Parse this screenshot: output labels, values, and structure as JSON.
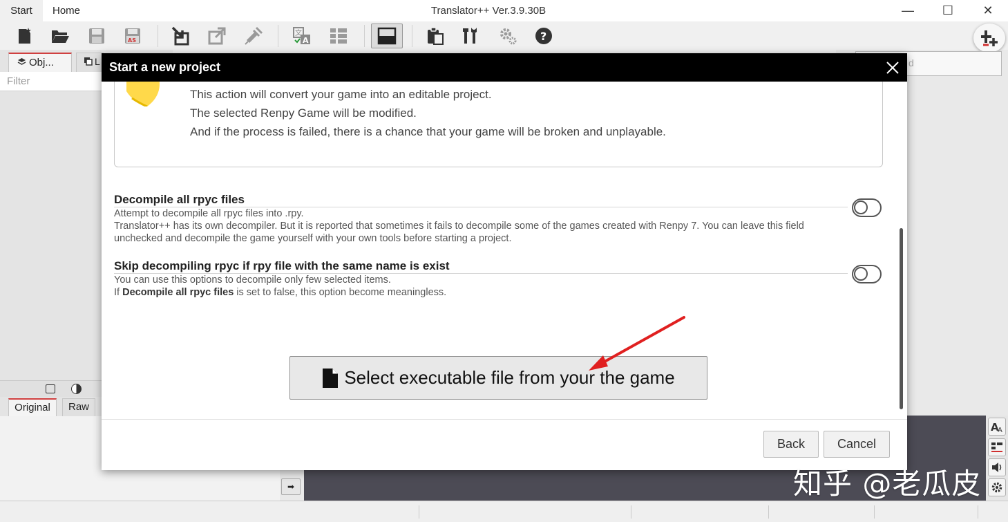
{
  "window": {
    "title": "Translator++ Ver.3.9.30B",
    "menus": [
      "Start",
      "Home"
    ],
    "minimize_glyph": "—",
    "maximize_glyph": "☐",
    "close_glyph": "✕"
  },
  "toolbar": {
    "icons": [
      "new-project-icon",
      "open-folder-icon",
      "save-icon",
      "save-as-icon",
      "import-icon",
      "export-icon",
      "inject-icon",
      "translate-icon",
      "list-view-icon",
      "layout-icon",
      "clipboard-icon",
      "tools-icon",
      "settings-icon",
      "help-icon"
    ],
    "add_glyph": "+"
  },
  "left_panel": {
    "tabs": [
      "Obj...",
      "L"
    ],
    "filter_placeholder": "Filter"
  },
  "behind": {
    "search_fragment": "d"
  },
  "lower_panel": {
    "tabs": [
      "Original",
      "Raw"
    ],
    "nav_arrow": "➡"
  },
  "modal": {
    "title": "Start a new project",
    "warning_lines": [
      "This action will convert your game into an editable project.",
      "The selected Renpy Game will be modified.",
      "And if the process is failed, there is a chance that your game will be broken and unplayable."
    ],
    "options": [
      {
        "title": "Decompile all rpyc files",
        "desc_line1": "Attempt to decompile all rpyc files into .rpy.",
        "desc_line2": "Translator++ has its own decompiler. But it is reported that sometimes it fails to decompile some of the games created with Renpy 7. You can leave this field unchecked and decompile the game yourself with your own tools before starting a project.",
        "enabled": false
      },
      {
        "title": "Skip decompiling rpyc if rpy file with the same name is exist",
        "desc_line1": "You can use this options to decompile only few selected items.",
        "desc_prefix": "If ",
        "desc_bold": "Decompile all rpyc files",
        "desc_suffix": " is set to false, this option become meaningless.",
        "enabled": false
      }
    ],
    "select_button": "Select executable file from your the game",
    "back_button": "Back",
    "cancel_button": "Cancel"
  },
  "watermark": "知乎 @老瓜皮",
  "colors": {
    "modal_header": "#000000",
    "annotation_arrow": "#e02020",
    "dark_panel": "#4c4b55",
    "tab_accent": "#d04040"
  }
}
